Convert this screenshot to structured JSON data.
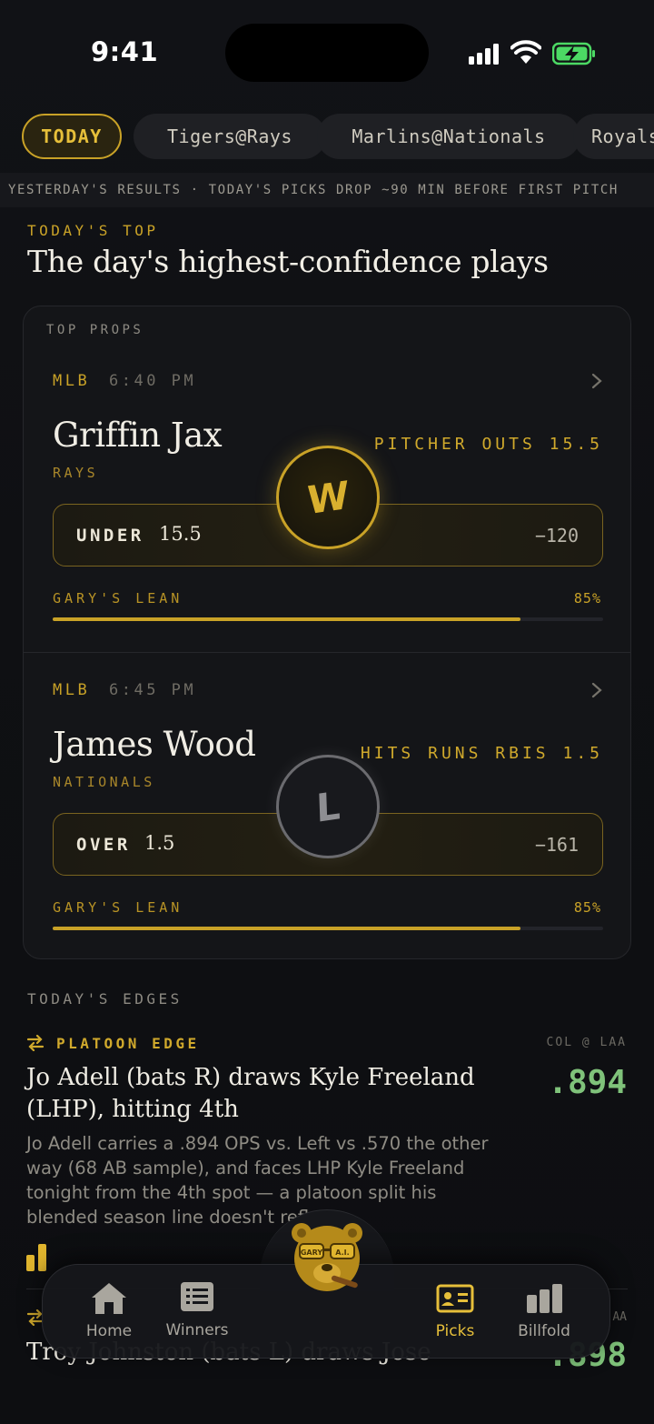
{
  "status_bar": {
    "time": "9:41"
  },
  "game_tabs": [
    {
      "label": "TODAY",
      "active": true
    },
    {
      "label": "Tigers@Rays",
      "active": false
    },
    {
      "label": "Marlins@Nationals",
      "active": false
    },
    {
      "label": "Royals",
      "active": false
    }
  ],
  "ticker": "YESTERDAY'S RESULTS · TODAY'S PICKS DROP ~90 MIN BEFORE FIRST PITCH",
  "top_section": {
    "kicker": "TODAY'S TOP",
    "title": "The day's highest-confidence plays"
  },
  "props_card": {
    "heading": "TOP PROPS",
    "props": [
      {
        "league": "MLB",
        "time": "6:40 PM",
        "player": "Griffin Jax",
        "team": "RAYS",
        "market": "PITCHER OUTS 15.5",
        "pick_side": "UNDER",
        "pick_line": "15.5",
        "odds": "−120",
        "lean_label": "GARY'S LEAN",
        "lean_pct": "85%",
        "lean_value": 0.85,
        "result": "W"
      },
      {
        "league": "MLB",
        "time": "6:45 PM",
        "player": "James Wood",
        "team": "NATIONALS",
        "market": "HITS RUNS RBIS 1.5",
        "pick_side": "OVER",
        "pick_line": "1.5",
        "odds": "−161",
        "lean_label": "GARY'S LEAN",
        "lean_pct": "85%",
        "lean_value": 0.85,
        "result": "L"
      }
    ]
  },
  "edges": {
    "kicker": "TODAY'S EDGES",
    "items": [
      {
        "tag": "PLATOON EDGE",
        "matchup": "COL @ LAA",
        "value": ".894",
        "headline": "Jo Adell (bats R) draws Kyle Freeland (LHP), hitting 4th",
        "body": "Jo Adell carries a .894 OPS vs. Left vs .570 the other way (68 AB sample), and faces LHP Kyle Freeland tonight from the 4th spot — a platoon split his blended season line doesn't reflect."
      },
      {
        "matchup": "AA",
        "value": ".898",
        "headline": "Troy Johnston (bats L) draws Jose"
      }
    ]
  },
  "tab_bar": {
    "items": [
      {
        "label": "Home",
        "icon": "home-icon",
        "active": false
      },
      {
        "label": "Winners",
        "icon": "list-icon",
        "active": false
      },
      {
        "label": "Picks",
        "icon": "id-card-icon",
        "active": true
      },
      {
        "label": "Billfold",
        "icon": "bar-chart-icon",
        "active": false
      }
    ],
    "mascot_text": "GARY A.I."
  },
  "colors": {
    "accent_gold": "#c9a227",
    "edge_green": "#7fc27a",
    "background": "#0e0f12"
  }
}
